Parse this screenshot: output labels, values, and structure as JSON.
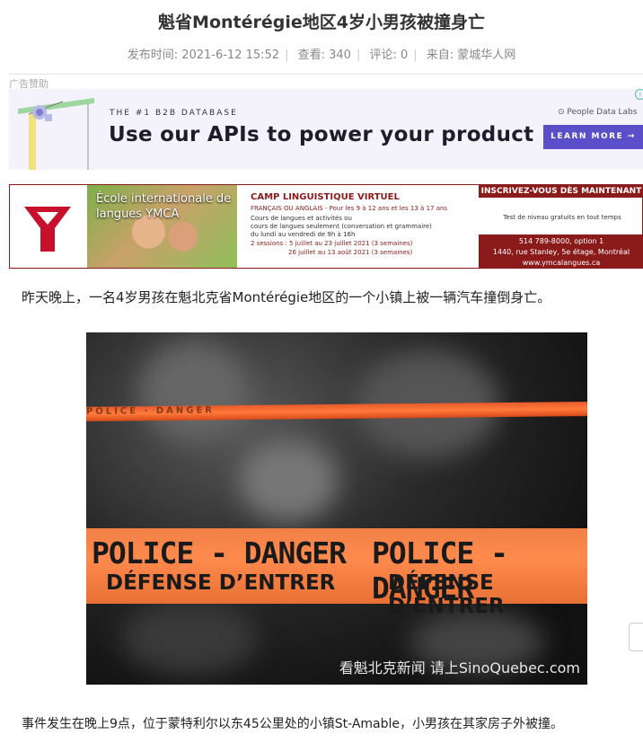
{
  "article": {
    "title": "魁省Montérégie地区4岁小男孩被撞身亡",
    "meta": {
      "published": "发布时间: 2021-6-12 15:52",
      "views": "查看: 340",
      "comments": "评论: 0",
      "source": "来自: 蒙城华人网"
    },
    "paragraph1": "昨天晚上，一名4岁男孩在魁北克省Montérégie地区的一个小镇上被一辆汽车撞倒身亡。",
    "paragraph2": "事件发生在晚上9点，位于蒙特利尔以东45公里处的小镇St-Amable，小男孩在其家房子外被撞。",
    "photo": {
      "tape_small": "POLICE · DANGER",
      "tape_line1": "POLICE - DANGER",
      "tape_line2": "DÉFENSE D’ENTRER",
      "watermark": "看魁北克新闻 请上SinoQuebec.com"
    }
  },
  "ads": {
    "label": "广告赞助",
    "ad1": {
      "tagline": "THE #1 B2B DATABASE",
      "headline": "Use our APIs to power your product",
      "brand": "People Data Labs",
      "cta": "LEARN MORE →",
      "info_icon": "i"
    },
    "ad2": {
      "ecole": "École internationale de langues YMCA",
      "camp_title": "CAMP LINGUISTIQUE VIRTUEL",
      "camp_sub": "FRANÇAIS OU ANGLAIS - Pour les 9 à 12 ans et les 13 à 17 ans",
      "line1": "Cours de langues et activités  ou",
      "line2": "cours de langues seulement (conversation et grammaire)",
      "line3": "du lundi au vendredi de 9h à 16h",
      "line4": "2 sessions : 5 juillet au 23 juillet 2021 (3 semaines)",
      "line5": "26 juillet au 13 août 2021 (3 semaines)",
      "inscrivez": "INSCRIVEZ-VOUS DÈS MAINTENANT",
      "test": "Test de niveau gratuits en tout temps",
      "phone": "514 789-8000, option 1",
      "address": "1440, rue Stanley, 5e étage, Montréal",
      "website": "www.ymcalangues.ca"
    }
  },
  "colors": {
    "ad1_button": "#5a4fc8",
    "ymca_red": "#8b1a1a",
    "tape_orange": "#ff7a3a"
  }
}
